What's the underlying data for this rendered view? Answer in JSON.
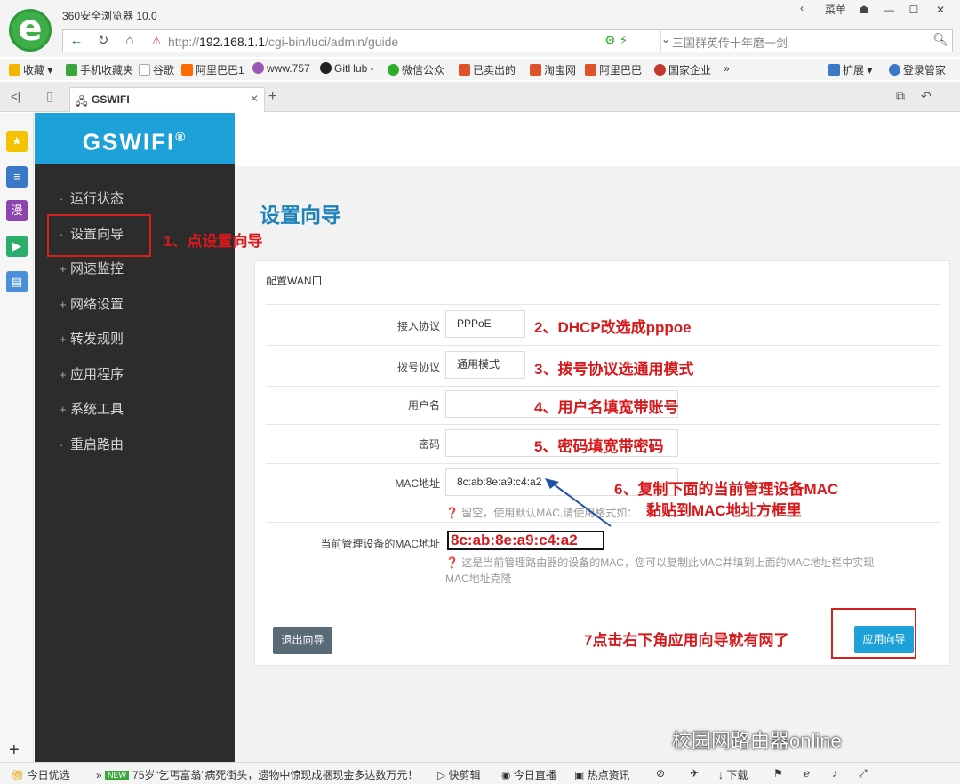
{
  "browser": {
    "app_title": "360安全浏览器 10.0",
    "menu_label": "菜单",
    "url_host": "192.168.1.1",
    "url_prefix": "http://",
    "url_path": "/cgi-bin/luci/admin/guide",
    "search_placeholder": "三国群英传十年磨一剑",
    "bookmarks": [
      {
        "label": "收藏",
        "color": "#f5b400"
      },
      {
        "label": "手机收藏夹",
        "color": "#3aa53a"
      },
      {
        "label": "谷歌",
        "color": "#cccccc"
      },
      {
        "label": "阿里巴巴1",
        "color": "#ff6a00"
      },
      {
        "label": "www.757",
        "color": "#9b59b6"
      },
      {
        "label": "GitHub -",
        "color": "#222222"
      },
      {
        "label": "微信公众",
        "color": "#2aae2a"
      },
      {
        "label": "已卖出的",
        "color": "#e0532a"
      },
      {
        "label": "淘宝网",
        "color": "#e0532a"
      },
      {
        "label": "阿里巴巴",
        "color": "#e0532a"
      },
      {
        "label": "国家企业",
        "color": "#c0392b"
      },
      {
        "label": "扩展",
        "color": "#3a78c8"
      },
      {
        "label": "登录管家",
        "color": "#3a78c8"
      }
    ],
    "tab_title": "GSWIFI"
  },
  "sidebar": {
    "brand": "GSWIFI",
    "brand_mark": "®",
    "items": [
      {
        "prefix": "·",
        "label": "运行状态"
      },
      {
        "prefix": "·",
        "label": "设置向导"
      },
      {
        "prefix": "+",
        "label": "网速监控"
      },
      {
        "prefix": "+",
        "label": "网络设置"
      },
      {
        "prefix": "+",
        "label": "转发规则"
      },
      {
        "prefix": "+",
        "label": "应用程序"
      },
      {
        "prefix": "+",
        "label": "系统工具"
      },
      {
        "prefix": "·",
        "label": "重启路由"
      }
    ]
  },
  "page": {
    "title": "设置向导",
    "panel_title": "配置WAN口",
    "fields": {
      "protocol_label": "接入协议",
      "protocol_value": "PPPoE",
      "dial_label": "拨号协议",
      "dial_value": "通用模式",
      "username_label": "用户名",
      "username_value": "",
      "password_label": "密码",
      "password_value": "",
      "mac_label": "MAC地址",
      "mac_value": "8c:ab:8e:a9:c4:a2",
      "mac_hint": "❓ 留空，使用默认MAC,请使用格式如：",
      "current_mac_label": "当前管理设备的MAC地址",
      "current_mac_value": "8c:ab:8e:a9:c4:a2",
      "current_mac_hint_1": "❓ 这是当前管理路由器的设备的MAC，您可以复制此MAC并填到上面的MAC地址栏中实现",
      "current_mac_hint_2": "MAC地址克隆"
    },
    "buttons": {
      "exit": "退出向导",
      "apply": "应用向导"
    }
  },
  "annotations": {
    "step1": "1、点设置向导",
    "step2": "2、DHCP改选成pppoe",
    "step3": "3、拨号协议选通用模式",
    "step4": "4、用户名填宽带账号",
    "step5": "5、密码填宽带密码",
    "step6a": "6、复制下面的当前管理设备MAC",
    "step6b": "黏贴到MAC地址方框里",
    "step7": "7点击右下角应用向导就有网了"
  },
  "watermark": "校园网路由器online",
  "statusbar": {
    "today": "今日优选",
    "new_badge": "NEW",
    "news": "75岁“乞丐富翁”病死街头，遗物中惊现成捆现金多达数万元！",
    "items": [
      "快剪辑",
      "今日直播",
      "热点资讯",
      "下载"
    ]
  }
}
